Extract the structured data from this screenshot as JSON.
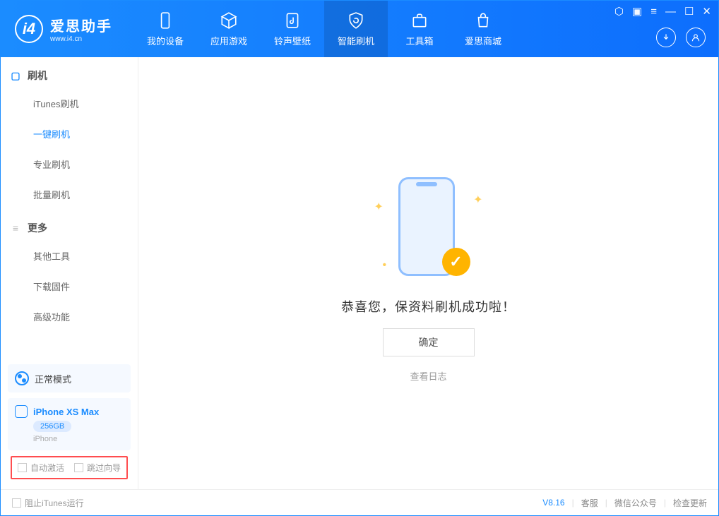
{
  "app": {
    "title": "爱思助手",
    "subtitle": "www.i4.cn"
  },
  "nav": {
    "my_device": "我的设备",
    "apps_games": "应用游戏",
    "ring_wall": "铃声壁纸",
    "smart_flash": "智能刷机",
    "toolbox": "工具箱",
    "store": "爱思商城"
  },
  "sidebar": {
    "group_flash": "刷机",
    "items_flash": {
      "itunes": "iTunes刷机",
      "oneclick": "一键刷机",
      "pro": "专业刷机",
      "batch": "批量刷机"
    },
    "group_more": "更多",
    "items_more": {
      "other_tools": "其他工具",
      "download_fw": "下载固件",
      "advanced": "高级功能"
    },
    "mode_label": "正常模式",
    "device_name": "iPhone XS Max",
    "device_storage": "256GB",
    "device_type": "iPhone",
    "cb_auto_activate": "自动激活",
    "cb_skip_guide": "跳过向导"
  },
  "main": {
    "success_text": "恭喜您，保资料刷机成功啦！",
    "ok_button": "确定",
    "view_log": "查看日志"
  },
  "footer": {
    "block_itunes": "阻止iTunes运行",
    "version": "V8.16",
    "support": "客服",
    "wechat": "微信公众号",
    "check_update": "检查更新"
  }
}
